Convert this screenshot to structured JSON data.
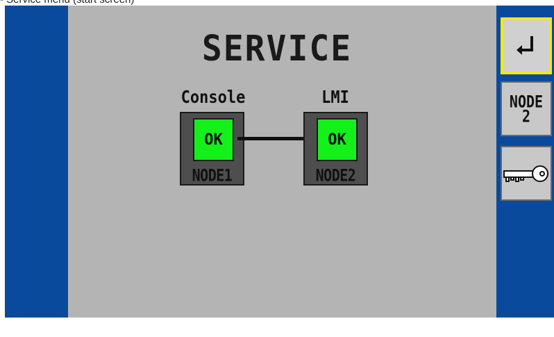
{
  "caption": "- Service menu (start screen)",
  "screen": {
    "title": "SERVICE"
  },
  "nodes": [
    {
      "label": "Console",
      "status": "OK",
      "id": "NODE1"
    },
    {
      "label": "LMI",
      "status": "OK",
      "id": "NODE2"
    }
  ],
  "sidebar": {
    "enter_icon": "↲",
    "node_button_lines": [
      "NODE",
      "2"
    ],
    "key_icon": "key-icon"
  },
  "colors": {
    "side_strip": "#0a4a9c",
    "panel": "#b4b4b4",
    "node_ok": "#13f01a",
    "node_frame": "#4e4e4e",
    "selected_border": "#f4ea00"
  }
}
